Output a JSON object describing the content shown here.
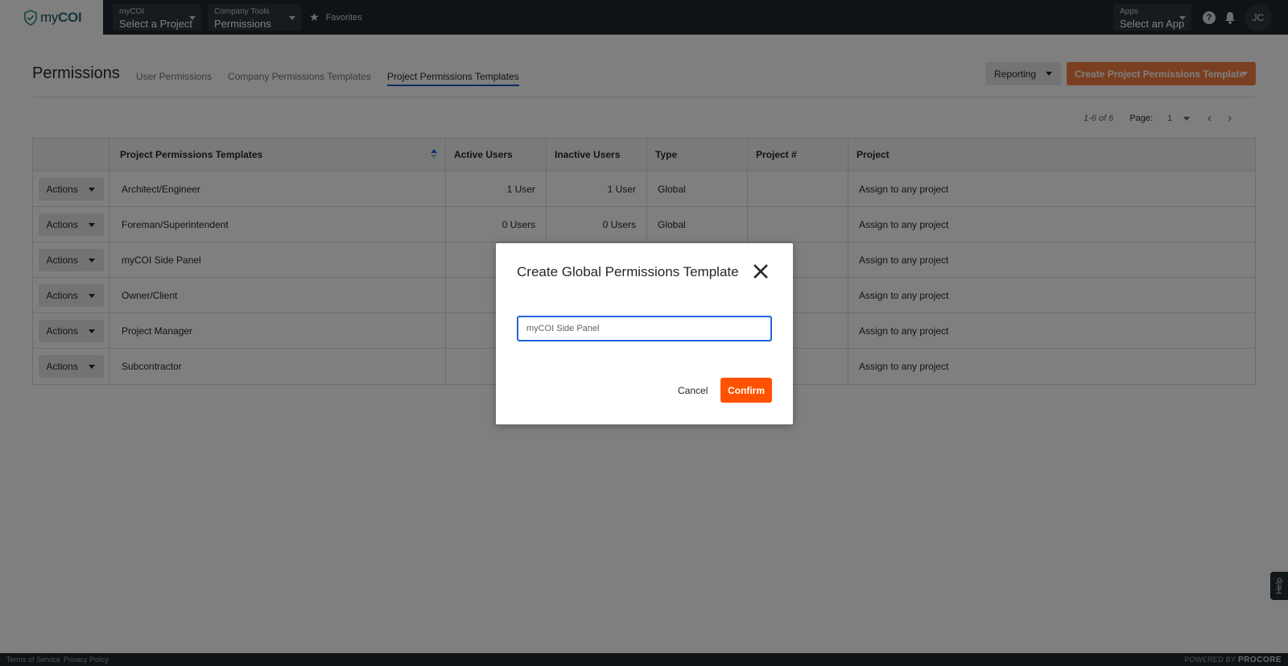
{
  "nav": {
    "logo": {
      "prefix": "my",
      "suffix": "COI"
    },
    "project_select": {
      "label": "myCOI",
      "value": "Select a Project"
    },
    "tools_select": {
      "label": "Company Tools",
      "value": "Permissions"
    },
    "favorites_label": "Favorites",
    "apps_select": {
      "label": "Apps",
      "value": "Select an App"
    },
    "help_icon_glyph": "?",
    "avatar_initials": "JC"
  },
  "page": {
    "title": "Permissions",
    "tabs": [
      {
        "label": "User Permissions",
        "active": false
      },
      {
        "label": "Company Permissions Templates",
        "active": false
      },
      {
        "label": "Project Permissions Templates",
        "active": true
      }
    ],
    "reporting_label": "Reporting",
    "create_label": "Create Project Permissions Template"
  },
  "pager": {
    "range": "1-6 of 6",
    "page_label": "Page:",
    "page_value": "1",
    "prev_glyph": "‹",
    "next_glyph": "›"
  },
  "table": {
    "columns": [
      "Project Permissions Templates",
      "Active Users",
      "Inactive Users",
      "Type",
      "Project #",
      "Project"
    ],
    "action_label": "Actions",
    "rows": [
      {
        "name": "Architect/Engineer",
        "active": "1 User",
        "inactive": "1 User",
        "type": "Global",
        "project_num": "",
        "project": "Assign to any project"
      },
      {
        "name": "Foreman/Superintendent",
        "active": "0 Users",
        "inactive": "0 Users",
        "type": "Global",
        "project_num": "",
        "project": "Assign to any project"
      },
      {
        "name": "myCOI Side Panel",
        "active": "",
        "inactive": "",
        "type": "",
        "project_num": "",
        "project": "Assign to any project"
      },
      {
        "name": "Owner/Client",
        "active": "",
        "inactive": "",
        "type": "",
        "project_num": "",
        "project": "Assign to any project"
      },
      {
        "name": "Project Manager",
        "active": "",
        "inactive": "",
        "type": "",
        "project_num": "",
        "project": "Assign to any project"
      },
      {
        "name": "Subcontractor",
        "active": "",
        "inactive": "",
        "type": "",
        "project_num": "",
        "project": "Assign to any project"
      }
    ]
  },
  "modal": {
    "title": "Create Global Permissions Template",
    "input_value": "myCOI Side Panel",
    "cancel_label": "Cancel",
    "confirm_label": "Confirm"
  },
  "footer": {
    "terms": "Terms of Service",
    "privacy": "Privacy Policy",
    "powered_by": "POWERED BY",
    "brand": "PROCORE"
  },
  "help_tab_label": "Help",
  "colors": {
    "nav_bg": "#1e272e",
    "accent_orange": "#ff5200",
    "create_button": "#f47e42",
    "focus_blue": "#2066df"
  }
}
